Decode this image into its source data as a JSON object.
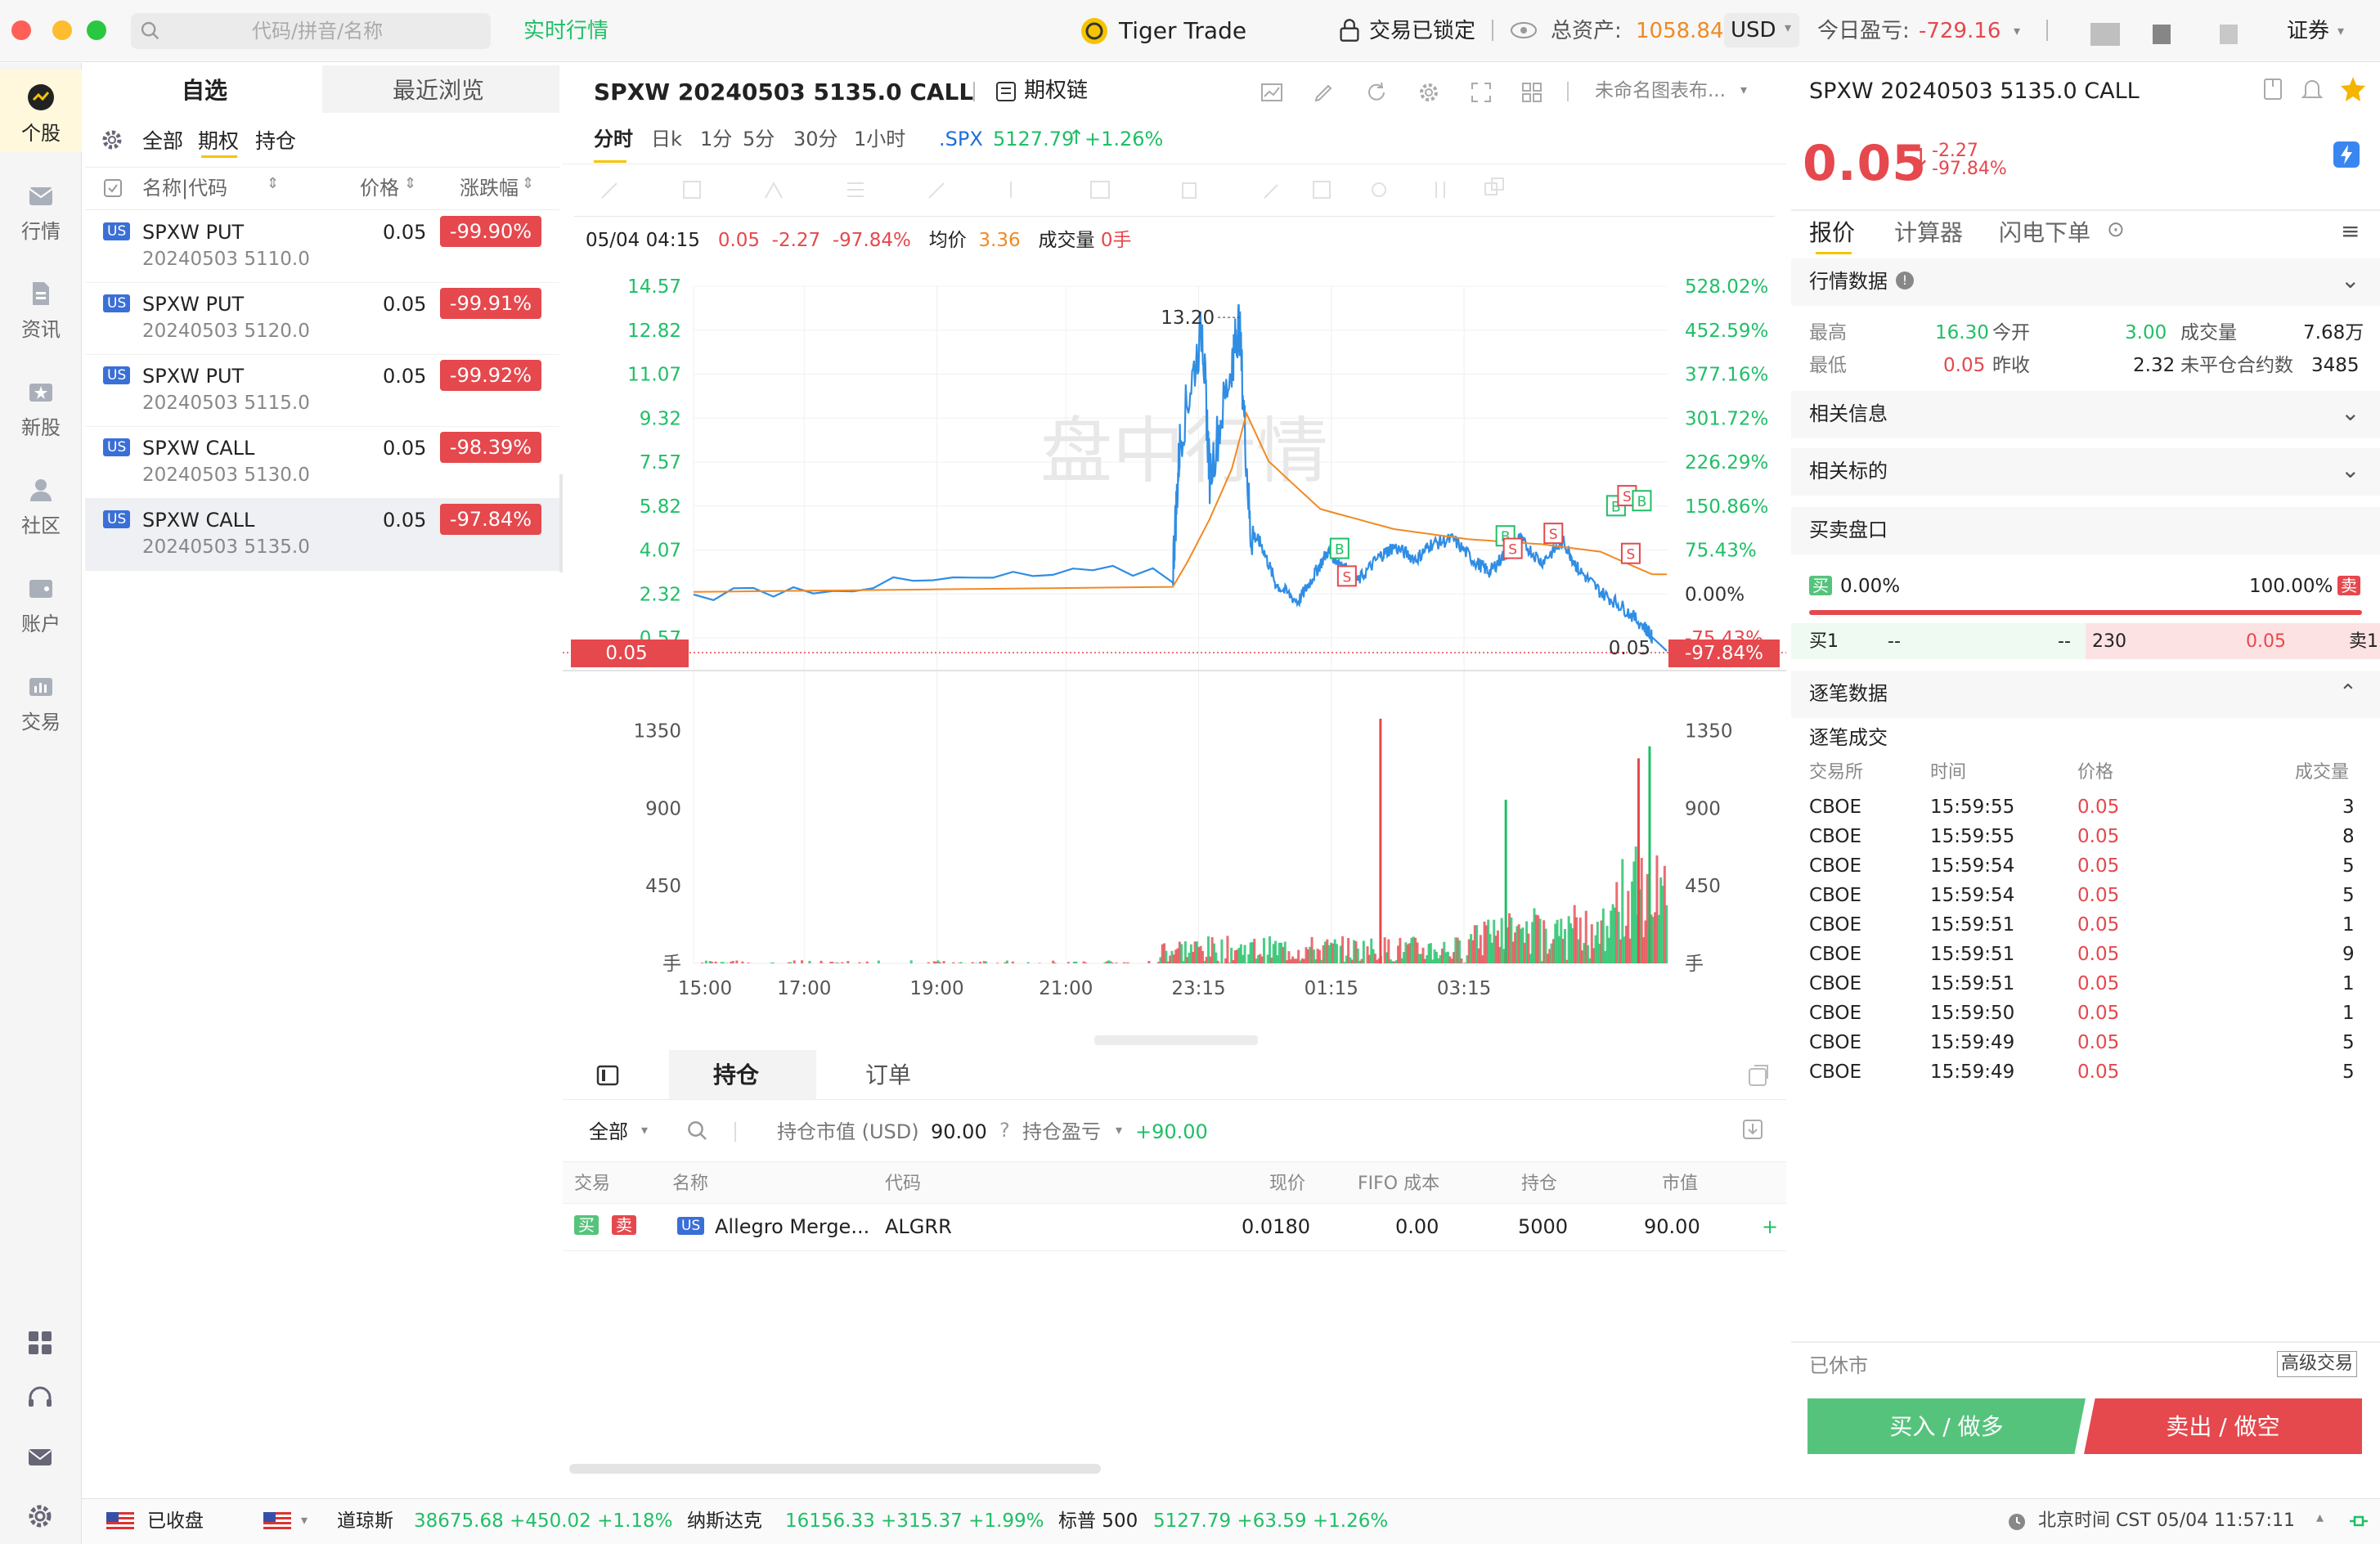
{
  "titlebar": {
    "search_placeholder": "代码/拼音/名称",
    "realtime": "实时行情",
    "app_title": "Tiger Trade",
    "locked": "交易已锁定",
    "total_assets_label": "总资产:",
    "total_assets": "1058.84",
    "currency": "USD",
    "today_pl_label": "今日盈亏:",
    "today_pl": "-729.16",
    "securities": "证券"
  },
  "nav": [
    {
      "label": "个股",
      "icon": "stock-icon"
    },
    {
      "label": "行情",
      "icon": "market-icon"
    },
    {
      "label": "资讯",
      "icon": "news-icon"
    },
    {
      "label": "新股",
      "icon": "ipo-icon"
    },
    {
      "label": "社区",
      "icon": "community-icon"
    },
    {
      "label": "账户",
      "icon": "account-icon"
    },
    {
      "label": "交易",
      "icon": "trade-icon"
    }
  ],
  "watchlist": {
    "tabs": [
      "自选",
      "最近浏览"
    ],
    "filters": [
      "全部",
      "期权",
      "持仓"
    ],
    "headers": {
      "name": "名称|代码",
      "price": "价格",
      "change": "涨跌幅"
    },
    "rows": [
      {
        "market": "US",
        "name": "SPXW PUT",
        "code": "20240503 5110.0",
        "price": "0.05",
        "change": "-99.90%"
      },
      {
        "market": "US",
        "name": "SPXW PUT",
        "code": "20240503 5120.0",
        "price": "0.05",
        "change": "-99.91%"
      },
      {
        "market": "US",
        "name": "SPXW PUT",
        "code": "20240503 5115.0",
        "price": "0.05",
        "change": "-99.92%"
      },
      {
        "market": "US",
        "name": "SPXW CALL",
        "code": "20240503 5130.0",
        "price": "0.05",
        "change": "-98.39%"
      },
      {
        "market": "US",
        "name": "SPXW CALL",
        "code": "20240503 5135.0",
        "price": "0.05",
        "change": "-97.84%"
      }
    ]
  },
  "chart_panel": {
    "title": "SPXW 20240503 5135.0 CALL",
    "option_chain": "期权链",
    "layout": "未命名图表布...",
    "periods": [
      "分时",
      "日k",
      "1分",
      "5分",
      "30分",
      "1小时"
    ],
    "underlying": ".SPX",
    "underlying_price": "5127.79",
    "underlying_change": "+1.26%",
    "info": {
      "time": "05/04 04:15",
      "price": "0.05",
      "chg": "-2.27",
      "pct": "-97.84%",
      "avg_label": "均价",
      "avg": "3.36",
      "vol_label": "成交量",
      "vol": "0手"
    },
    "watermark": "盘中行情",
    "high_marker": "13.20",
    "last_marker": "0.05",
    "last_price_tag": "0.05",
    "last_pct_tag": "-97.84%",
    "vol_unit": "手"
  },
  "chart_data": {
    "type": "line",
    "x_ticks": [
      "15:00",
      "17:00",
      "19:00",
      "21:00",
      "23:15",
      "01:15",
      "03:15"
    ],
    "y_left": [
      "14.57",
      "12.82",
      "11.07",
      "9.32",
      "7.57",
      "5.82",
      "4.07",
      "2.32",
      "0.57"
    ],
    "y_right": [
      "528.02%",
      "452.59%",
      "377.16%",
      "301.72%",
      "226.29%",
      "150.86%",
      "75.43%",
      "0.00%",
      "-75.43%"
    ],
    "vol_ticks": [
      "1350",
      "900",
      "450"
    ],
    "ylim": [
      0.57,
      14.57
    ],
    "prev_close": 2.32,
    "series": [
      {
        "name": "",
        "color": "#2f8de4",
        "x": [
          0,
          6.5,
          6.6,
          6.9,
          7.0,
          7.3,
          7.4,
          7.55,
          7.7,
          7.9,
          8.2,
          8.4,
          8.6,
          8.8,
          9.0,
          9.3,
          9.5,
          9.8,
          10.0,
          10.3,
          10.6,
          10.8,
          11.0,
          11.2,
          11.5,
          11.8,
          12.0,
          12.3,
          12.6,
          12.9,
          13.0,
          13.2
        ],
        "y": [
          2.3,
          3.3,
          8.5,
          12.9,
          7.0,
          11.5,
          13.2,
          4.8,
          4.3,
          2.7,
          2.0,
          3.0,
          4.0,
          3.5,
          2.8,
          3.8,
          4.2,
          3.7,
          4.3,
          4.5,
          3.6,
          3.2,
          3.9,
          4.5,
          3.6,
          4.4,
          3.3,
          2.4,
          1.8,
          1.0,
          0.6,
          0.05
        ]
      },
      {
        "name": "",
        "color": "#f08a24",
        "x": [
          0,
          6.5,
          6.7,
          7.0,
          7.3,
          7.5,
          7.8,
          8.5,
          9.5,
          10.5,
          11.5,
          12.3,
          13.0,
          13.2
        ],
        "y": [
          2.4,
          2.6,
          3.6,
          5.3,
          7.3,
          9.5,
          7.6,
          5.7,
          4.9,
          4.5,
          4.3,
          4.0,
          3.1,
          3.1
        ]
      }
    ],
    "volume_peaks": [
      {
        "x": 9.3,
        "v": 1420
      },
      {
        "x": 11.0,
        "v": 950
      },
      {
        "x": 12.8,
        "v": 1190
      },
      {
        "x": 12.95,
        "v": 1260
      }
    ]
  },
  "trades_markers": [
    "B",
    "S",
    "B",
    "S",
    "S",
    "B",
    "S",
    "B",
    "S"
  ],
  "positions": {
    "tabs": [
      "持仓",
      "订单"
    ],
    "filter": "全部",
    "market_value_label": "持仓市值 (USD)",
    "market_value": "90.00",
    "pl_label": "持仓盈亏",
    "pl": "+90.00",
    "headers": [
      "交易",
      "名称",
      "代码",
      "现价",
      "FIFO 成本",
      "持仓",
      "市值"
    ],
    "rows": [
      {
        "buy": "买",
        "sell": "卖",
        "market": "US",
        "name": "Allegro Merge...",
        "code": "ALGRR",
        "price": "0.0180",
        "cost": "0.00",
        "qty": "5000",
        "value": "90.00"
      }
    ]
  },
  "right": {
    "title": "SPXW 20240503 5135.0 CALL",
    "price": "0.05",
    "chg": "-2.27",
    "pct": "-97.84%",
    "tabs": [
      "报价",
      "计算器",
      "闪电下单"
    ],
    "sections": {
      "market": "行情数据",
      "related_info": "相关信息",
      "related_underlying": "相关标的",
      "book": "买卖盘口",
      "ticks": "逐笔数据"
    },
    "stats": {
      "high_label": "最高",
      "high": "16.30",
      "open_label": "今开",
      "open": "3.00",
      "volume_label": "成交量",
      "volume": "7.68万",
      "low_label": "最低",
      "low": "0.05",
      "prev_label": "昨收",
      "prev": "2.32",
      "oi_label": "未平仓合约数",
      "oi": "3485"
    },
    "book": {
      "buy_label": "买",
      "buy_pct": "0.00%",
      "sell_pct": "100.00%",
      "sell_label": "卖",
      "bid1_label": "买1",
      "bid1_price": "--",
      "bid1_vol": "--",
      "ask1_vol": "230",
      "ask1_price": "0.05",
      "ask1_label": "卖1"
    },
    "ticks_title": "逐笔成交",
    "tick_headers": [
      "交易所",
      "时间",
      "价格",
      "成交量"
    ],
    "ticks": [
      [
        "CBOE",
        "15:59:55",
        "0.05",
        "3"
      ],
      [
        "CBOE",
        "15:59:55",
        "0.05",
        "8"
      ],
      [
        "CBOE",
        "15:59:54",
        "0.05",
        "5"
      ],
      [
        "CBOE",
        "15:59:54",
        "0.05",
        "5"
      ],
      [
        "CBOE",
        "15:59:51",
        "0.05",
        "1"
      ],
      [
        "CBOE",
        "15:59:51",
        "0.05",
        "9"
      ],
      [
        "CBOE",
        "15:59:51",
        "0.05",
        "1"
      ],
      [
        "CBOE",
        "15:59:50",
        "0.05",
        "1"
      ],
      [
        "CBOE",
        "15:59:49",
        "0.05",
        "5"
      ],
      [
        "CBOE",
        "15:59:49",
        "0.05",
        "5"
      ]
    ],
    "market_status": "已休市",
    "advanced": "高级交易",
    "buy_btn": "买入 / 做多",
    "sell_btn": "卖出 / 做空"
  },
  "statusbar": {
    "closed": "已收盘",
    "dow_label": "道琼斯",
    "dow": "38675.68 +450.02 +1.18%",
    "nasdaq_label": "纳斯达克",
    "nasdaq": "16156.33 +315.37 +1.99%",
    "sp_label": "标普 500",
    "sp": "5127.79 +63.59 +1.26%",
    "clock": "北京时间 CST 05/04 11:57:11"
  }
}
